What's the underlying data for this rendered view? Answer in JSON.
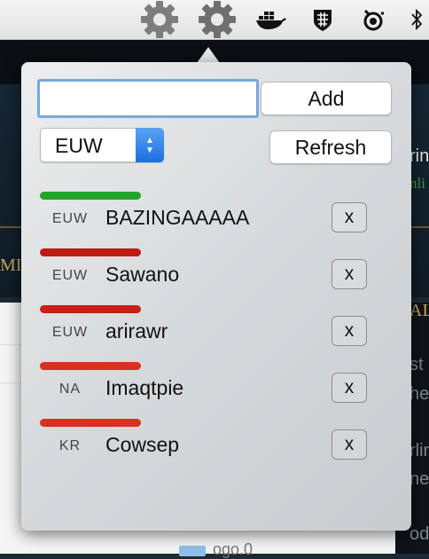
{
  "menubar": {
    "icons": [
      "gear-icon",
      "gear-icon",
      "docker-icon",
      "shield-icon",
      "steelseries-icon",
      "bluetooth-icon"
    ]
  },
  "background": {
    "ghost_texts": [
      "MI",
      "AL",
      "rin",
      "nli",
      "st",
      "he",
      "rlin",
      "ne",
      "od"
    ],
    "folder_label": "ogo.0"
  },
  "form": {
    "summoner_input": {
      "value": "",
      "placeholder": ""
    },
    "add_label": "Add",
    "refresh_label": "Refresh",
    "region_selected": "EUW",
    "region_options": [
      "EUW"
    ]
  },
  "colors": {
    "online": "#22a52a",
    "offline": "#bd1c14",
    "offline_light": "#d9301f",
    "focus_ring": "#7aa6e0",
    "accent": "#1d6fe0"
  },
  "summoners": [
    {
      "region": "EUW",
      "name": "BAZINGAAAAA",
      "status_color": "#22a52a",
      "remove_label": "x"
    },
    {
      "region": "EUW",
      "name": "Sawano",
      "status_color": "#bd1c14",
      "remove_label": "x"
    },
    {
      "region": "EUW",
      "name": "arirawr",
      "status_color": "#c81e14",
      "remove_label": "x"
    },
    {
      "region": "NA",
      "name": "Imaqtpie",
      "status_color": "#d9301f",
      "remove_label": "x"
    },
    {
      "region": "KR",
      "name": "Cowsep",
      "status_color": "#d9301f",
      "remove_label": "x"
    }
  ]
}
